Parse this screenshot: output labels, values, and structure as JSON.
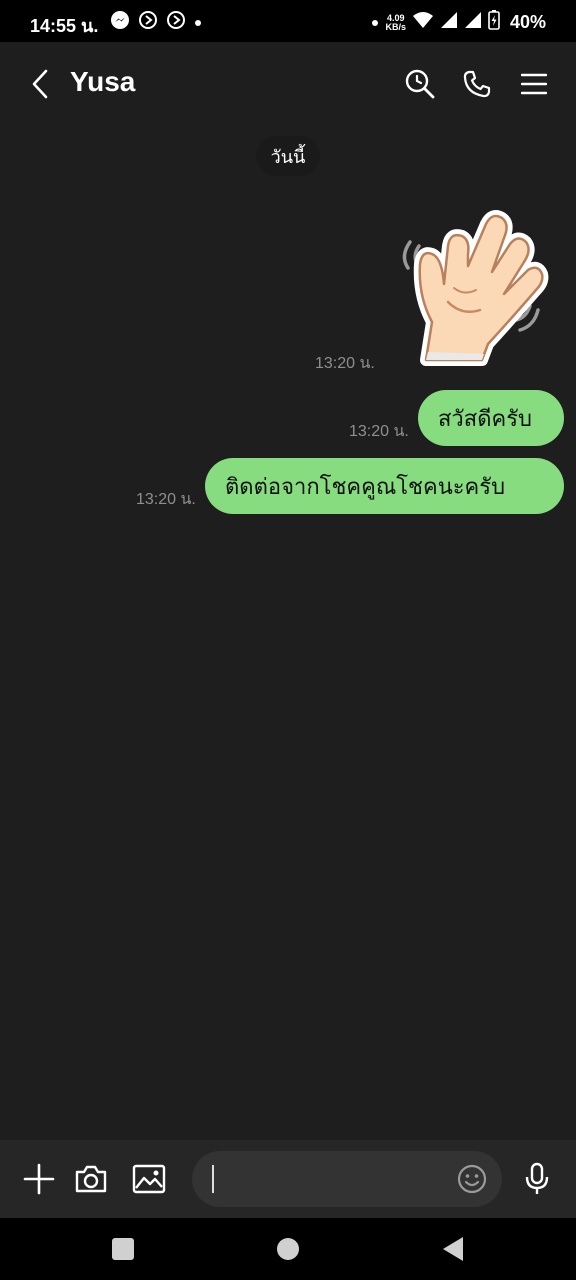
{
  "status_bar": {
    "time": "14:55 น.",
    "net_speed_value": "4.09",
    "net_speed_unit": "KB/s",
    "battery": "40%",
    "icons": [
      "messenger-icon",
      "dial-icon",
      "dial-icon",
      "dot-icon",
      "dot-icon",
      "wifi-icon",
      "signal-icon",
      "signal-icon",
      "battery-charging-icon"
    ]
  },
  "header": {
    "title": "Yusa",
    "icons": [
      "back-icon",
      "search-clock-icon",
      "phone-icon",
      "menu-icon"
    ]
  },
  "chat": {
    "date_label": "วันนี้",
    "messages": [
      {
        "type": "sticker",
        "sticker": "waving-hand",
        "time": "13:20 น."
      },
      {
        "type": "text",
        "text": "สวัสดีครับ",
        "time": "13:20 น."
      },
      {
        "type": "text",
        "text": "ติดต่อจากโชคคูณโชคนะครับ",
        "time": "13:20 น."
      }
    ]
  },
  "input_bar": {
    "message_value": "",
    "icons": [
      "plus-icon",
      "camera-icon",
      "image-icon",
      "emoji-icon",
      "mic-icon"
    ]
  },
  "nav_bar": {
    "icons": [
      "recents-icon",
      "home-icon",
      "back-triangle-icon"
    ]
  },
  "colors": {
    "background": "#1e1e1e",
    "bubble": "#86dc7f",
    "time_text": "#8f8f8f",
    "input_bar": "#262626"
  }
}
